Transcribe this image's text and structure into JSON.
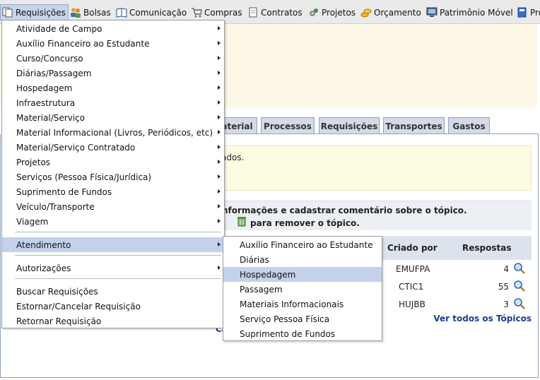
{
  "menubar": {
    "items": [
      {
        "label": "Requisições",
        "icon": "document-copy-icon"
      },
      {
        "label": "Bolsas",
        "icon": "users-icon"
      },
      {
        "label": "Comunicação",
        "icon": "book-icon"
      },
      {
        "label": "Compras",
        "icon": "cart-icon"
      },
      {
        "label": "Contratos",
        "icon": "document-icon"
      },
      {
        "label": "Projetos",
        "icon": "gears-icon"
      },
      {
        "label": "Orçamento",
        "icon": "coins-icon"
      },
      {
        "label": "Patrimônio Móvel",
        "icon": "monitor-icon"
      },
      {
        "label": "Pro",
        "icon": "book-blue-icon"
      }
    ]
  },
  "dropdown": {
    "items": [
      {
        "label": "Atividade de Campo",
        "submenu": true
      },
      {
        "label": "Auxílio Financeiro ao Estudante",
        "submenu": true
      },
      {
        "label": "Curso/Concurso",
        "submenu": true
      },
      {
        "label": "Diárias/Passagem",
        "submenu": true
      },
      {
        "label": "Hospedagem",
        "submenu": true
      },
      {
        "label": "Infraestrutura",
        "submenu": true
      },
      {
        "label": "Material/Serviço",
        "submenu": true
      },
      {
        "label": "Material Informacional (Livros, Periódicos, etc)",
        "submenu": true
      },
      {
        "label": "Material/Serviço Contratado",
        "submenu": true
      },
      {
        "label": "Projetos",
        "submenu": true
      },
      {
        "label": "Serviços (Pessoa Física/Jurídica)",
        "submenu": true
      },
      {
        "label": "Suprimento de Fundos",
        "submenu": true
      },
      {
        "label": "Veículo/Transporte",
        "submenu": true
      },
      {
        "label": "Viagem",
        "submenu": true
      },
      {
        "label": "Atendimento",
        "submenu": true,
        "highlighted": true
      },
      {
        "label": "Autorizações",
        "submenu": true
      },
      {
        "label": "Buscar Requisições",
        "submenu": false
      },
      {
        "label": "Estornar/Cancelar Requisição",
        "submenu": false
      },
      {
        "label": "Retornar Requisição",
        "submenu": false
      }
    ]
  },
  "submenu": {
    "items": [
      {
        "label": "Auxílio Financeiro ao Estudante"
      },
      {
        "label": "Diárias"
      },
      {
        "label": "Hospedagem",
        "highlighted": true
      },
      {
        "label": "Passagem"
      },
      {
        "label": "Materiais Informacionais"
      },
      {
        "label": "Serviço Pessoa Física"
      },
      {
        "label": "Suprimento de Fundos"
      }
    ]
  },
  "tabs": [
    "aterial",
    "Processos",
    "Requisições",
    "Transportes",
    "Gastos"
  ],
  "notice": {
    "text": "ados."
  },
  "info": {
    "line1": "nformações e cadastrar comentário sobre o tópico.",
    "line2": "para remover o tópico."
  },
  "topics": {
    "headers": {
      "created_by": "Criado por",
      "responses": "Respostas"
    },
    "rows": [
      {
        "created_by": "EMUFPA",
        "responses": "4"
      },
      {
        "created_by": "CTIC1",
        "responses": "55"
      },
      {
        "created_by": "HUJBB",
        "responses": "3"
      }
    ],
    "see_all": "Ver todos os Tópicos",
    "partial": "Ca"
  },
  "colors": {
    "highlight": "#c4d1ea",
    "border": "#8ea2c4",
    "link": "#1a3f8f"
  }
}
